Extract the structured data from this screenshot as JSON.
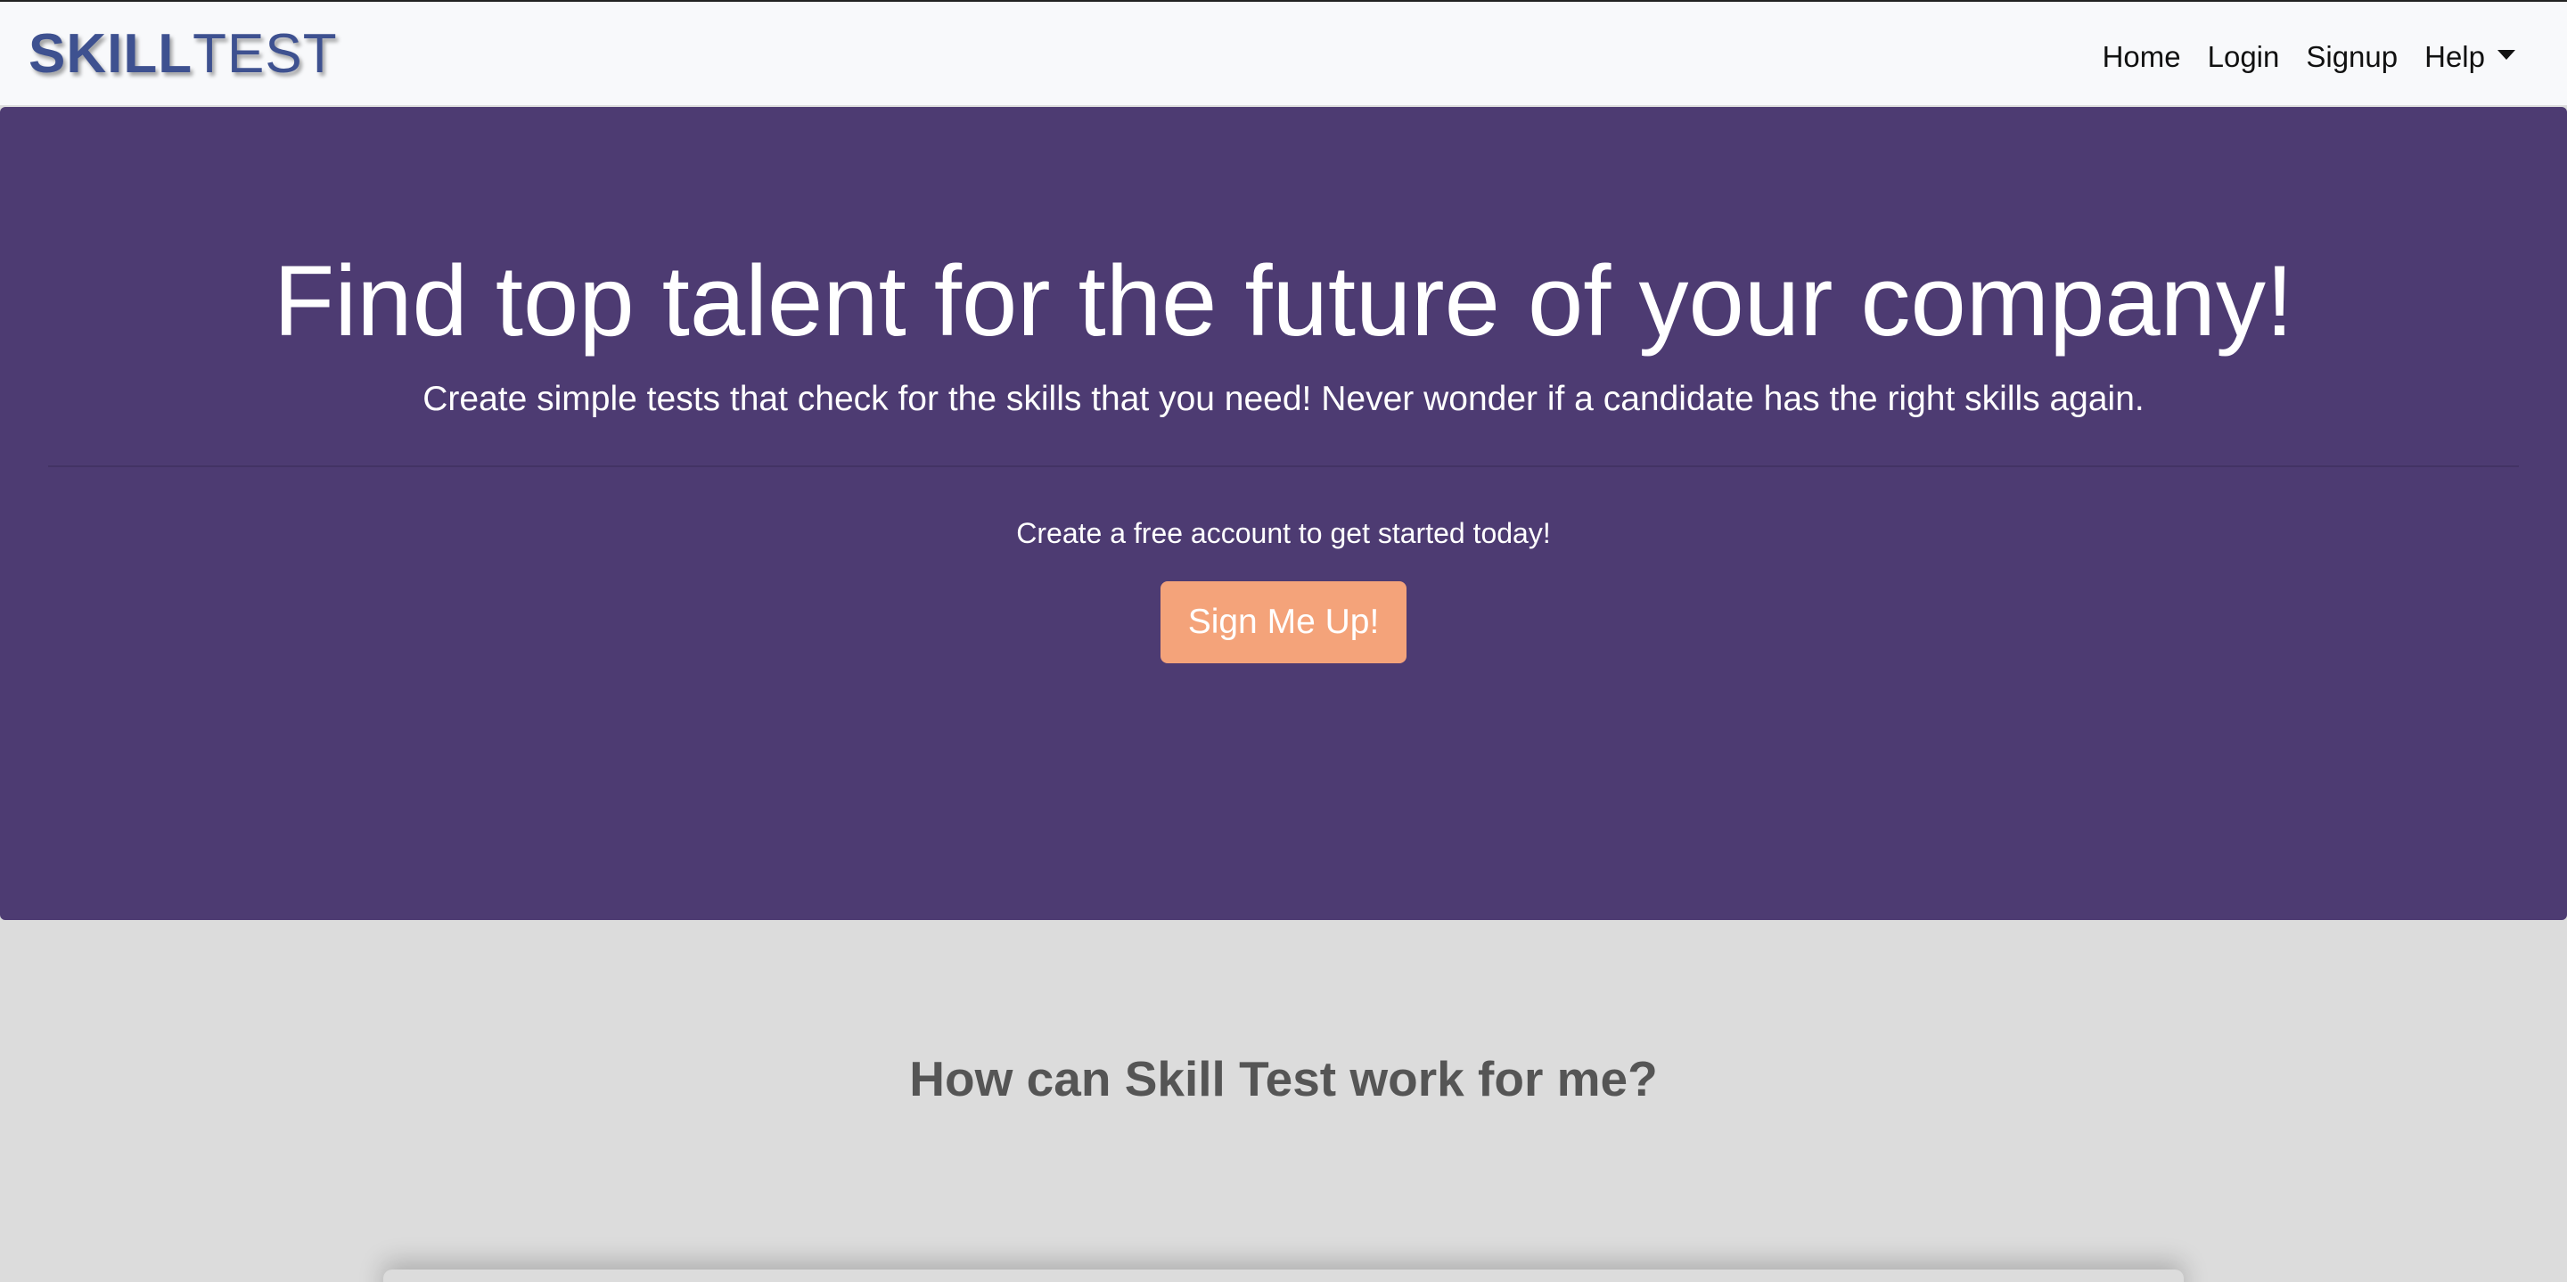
{
  "navbar": {
    "brand_bold": "SKILL",
    "brand_light": "TEST",
    "links": {
      "home": "Home",
      "login": "Login",
      "signup": "Signup",
      "help": "Help"
    }
  },
  "hero": {
    "title": "Find top talent for the future of your company!",
    "subtitle": "Create simple tests that check for the skills that you need! Never wonder if a candidate has the right skills again.",
    "cta_text": "Create a free account to get started today!",
    "cta_button": "Sign Me Up!"
  },
  "section": {
    "title": "How can Skill Test work for me?"
  },
  "colors": {
    "hero_background": "#4d3b72",
    "cta_button": "#f4a37a",
    "brand": "#3e5190",
    "page_background": "#dcdcdc"
  },
  "icons": {
    "help_dropdown": "caret-down-icon"
  }
}
